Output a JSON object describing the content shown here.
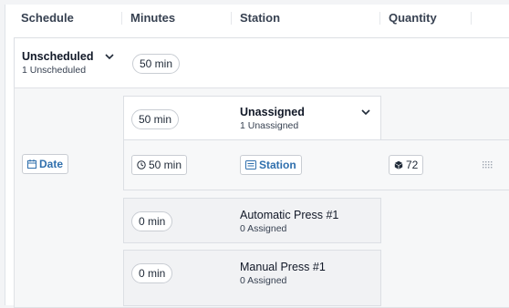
{
  "header": {
    "columns": [
      "Schedule",
      "Minutes",
      "Station",
      "Quantity"
    ]
  },
  "unscheduled": {
    "title": "Unscheduled",
    "subtitle": "1 Unscheduled",
    "minutes": "50 min"
  },
  "date_button": {
    "label": "Date"
  },
  "unassigned": {
    "title": "Unassigned",
    "subtitle": "1 Unassigned",
    "minutes": "50 min"
  },
  "task_row": {
    "minutes": "50 min",
    "station_button": "Station",
    "quantity": "72"
  },
  "stations": [
    {
      "minutes": "0 min",
      "name": "Automatic Press #1",
      "assigned": "0 Assigned"
    },
    {
      "minutes": "0 min",
      "name": "Manual Press #1",
      "assigned": "0 Assigned"
    }
  ],
  "colors": {
    "accent": "#2f6fad",
    "border": "#dcdfe4",
    "grey_bg": "#f6f7f8"
  },
  "icons": [
    "chevron-down-icon",
    "calendar-icon",
    "clock-icon",
    "station-icon",
    "cube-icon",
    "drag-handle-icon"
  ]
}
